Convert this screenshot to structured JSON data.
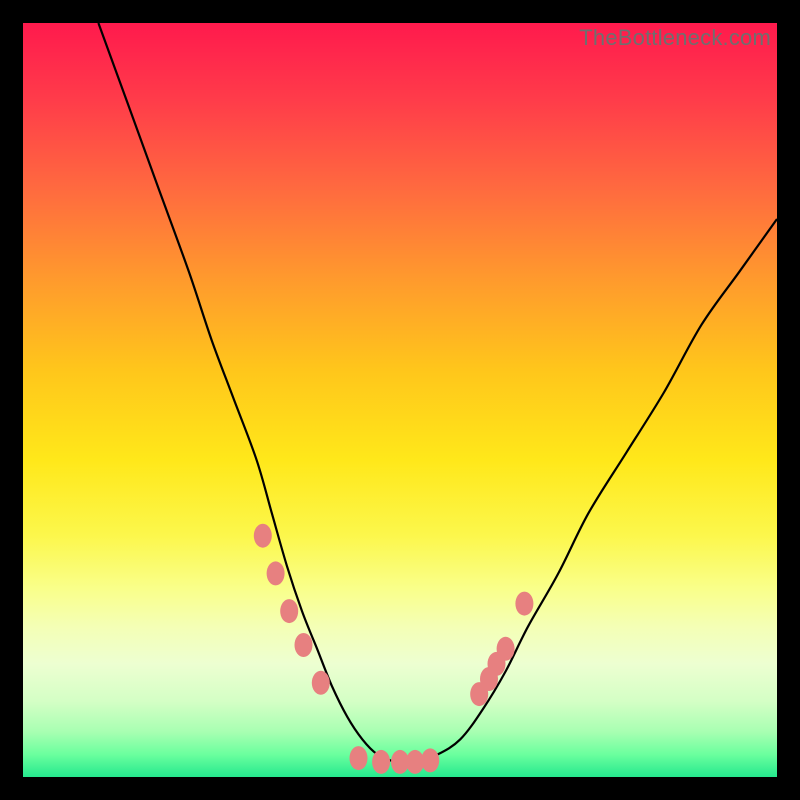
{
  "watermark": "TheBottleneck.com",
  "colors": {
    "frame": "#000000",
    "gradient_top": "#ff1a4d",
    "gradient_bottom": "#25e98e",
    "curve": "#000000",
    "beads": "#e78080",
    "watermark_text": "#6f6f6f"
  },
  "chart_data": {
    "type": "line",
    "title": "",
    "xlabel": "",
    "ylabel": "",
    "xlim": [
      0,
      100
    ],
    "ylim": [
      0,
      100
    ],
    "x": [
      10,
      14,
      18,
      22,
      25,
      28,
      31,
      33,
      35,
      37,
      39,
      41,
      43,
      45,
      47,
      49.5,
      52,
      55,
      58,
      61,
      64,
      67,
      71,
      75,
      80,
      85,
      90,
      95,
      100
    ],
    "values": [
      100,
      89,
      78,
      67,
      58,
      50,
      42,
      35,
      28,
      22,
      17,
      12,
      8,
      5,
      3,
      2,
      2,
      3,
      5,
      9,
      14,
      20,
      27,
      35,
      43,
      51,
      60,
      67,
      74
    ],
    "series_note": "V-shaped bottleneck curve; y≈0 is optimal (green), y≈100 is worst (red)",
    "beads_x": [
      31.8,
      33.5,
      35.3,
      37.2,
      39.5,
      44.5,
      47.5,
      50.0,
      52.0,
      54.0,
      60.5,
      61.8,
      62.8,
      64.0,
      66.5
    ],
    "beads_y": [
      32.0,
      27.0,
      22.0,
      17.5,
      12.5,
      2.5,
      2.0,
      2.0,
      2.0,
      2.2,
      11.0,
      13.0,
      15.0,
      17.0,
      23.0
    ]
  }
}
